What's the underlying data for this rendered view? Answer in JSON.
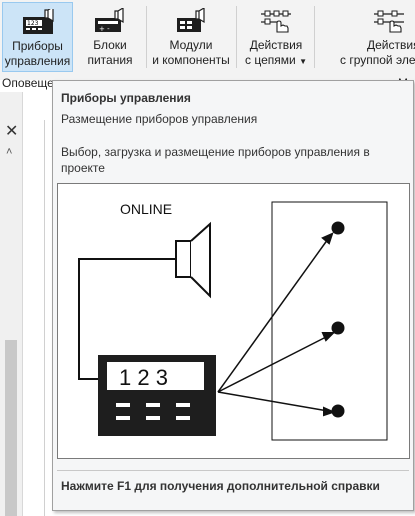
{
  "ribbon": {
    "buttons": [
      {
        "line1": "Приборы",
        "line2": "управления",
        "icon": "control-device-icon"
      },
      {
        "line1": "Блоки",
        "line2": "питания",
        "icon": "power-unit-icon"
      },
      {
        "line1": "Модули",
        "line2": "и компоненты",
        "icon": "module-icon"
      },
      {
        "line1": "Действия",
        "line2": "с цепями",
        "icon": "circuit-actions-icon"
      },
      {
        "line1": "Действия",
        "line2": "с группой эле",
        "icon": "group-actions-icon"
      }
    ],
    "group_label": "Оповеще",
    "group_label_right": "М"
  },
  "panel": {
    "close_glyph": "✕",
    "chevron_glyph": "˄"
  },
  "tooltip": {
    "title": "Приборы управления",
    "subtitle": "Размещение приборов управления",
    "description": "Выбор, загрузка и размещение приборов управления в проекте",
    "image_caption": "ONLINE",
    "display_digits": "1 2 3",
    "help": "Нажмите F1 для получения дополнительной справки"
  },
  "colors": {
    "active_button_bg": "#cce4f7",
    "active_button_border": "#99c9ef",
    "tooltip_bg": "#f5f6f7"
  }
}
